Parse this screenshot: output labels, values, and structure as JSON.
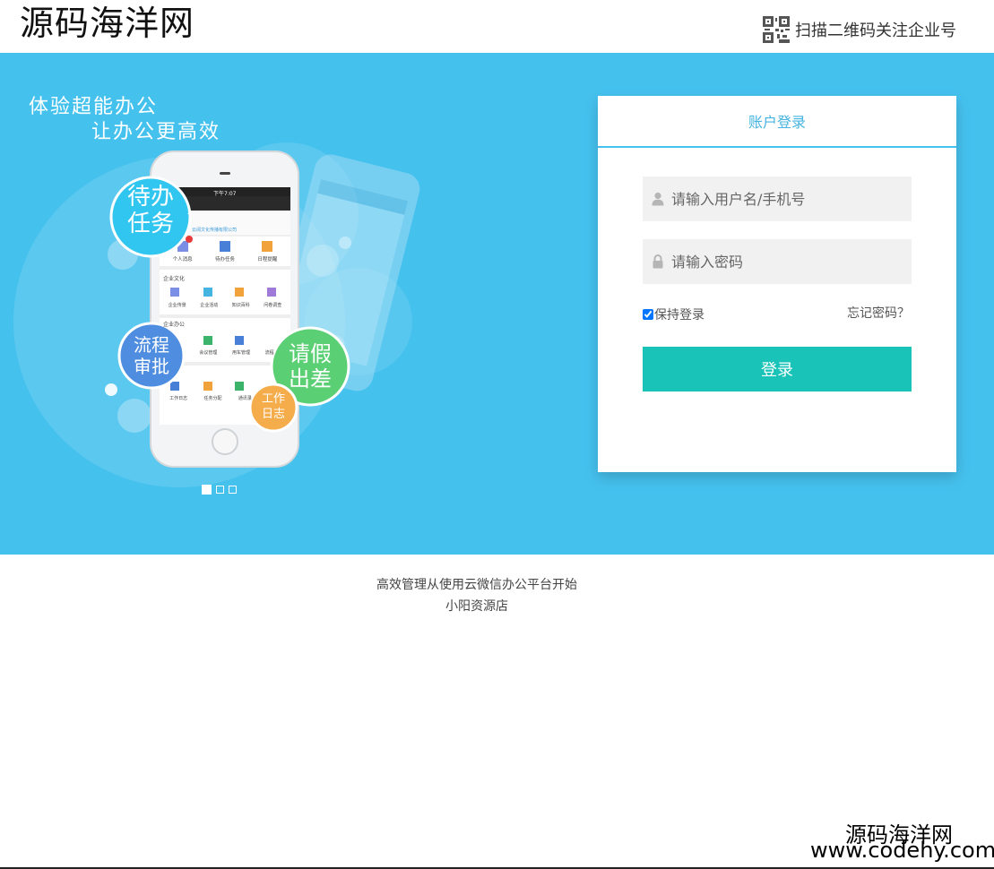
{
  "header": {
    "logo": "源码海洋网",
    "qr_text": "扫描二维码关注企业号",
    "qr_icon": "qr-code-icon"
  },
  "banner": {
    "slogan_line1": "体验超能办公",
    "slogan_line2": "让办公更高效",
    "background_color": "#45c1ee",
    "phone": {
      "status_time": "下午7:07",
      "app_title": "OA管理系统",
      "company": "云阔文化传播有限公司",
      "badge_count": "2",
      "row1": [
        "个人消息",
        "待办任务",
        "日程提醒"
      ],
      "section2": "企业文化",
      "row2": [
        "企业传景",
        "企业活动",
        "知识百科",
        "问卷调查"
      ],
      "section3": "企业办公",
      "row3": [
        "会议管理",
        "用车管理",
        "流程"
      ],
      "row4": [
        "工作日志",
        "任务分配",
        "通讯录"
      ]
    },
    "bubbles": {
      "todo": [
        "待办",
        "任务"
      ],
      "process": [
        "流程",
        "审批"
      ],
      "leave": [
        "请假",
        "出差"
      ],
      "log": [
        "工作",
        "日志"
      ]
    },
    "carousel": {
      "count": 3,
      "active": 0
    }
  },
  "login": {
    "title": "账户登录",
    "username_placeholder": "请输入用户名/手机号",
    "password_placeholder": "请输入密码",
    "remember_label": "保持登录",
    "remember_checked": true,
    "forgot_label": "忘记密码？",
    "submit_label": "登录",
    "accent_color": "#19c3b8"
  },
  "footer": {
    "line1": "高效管理从使用云微信办公平台开始",
    "line2": "小阳资源店"
  },
  "watermark": {
    "cn": "源码海洋网",
    "en": "www.codehy.com"
  }
}
